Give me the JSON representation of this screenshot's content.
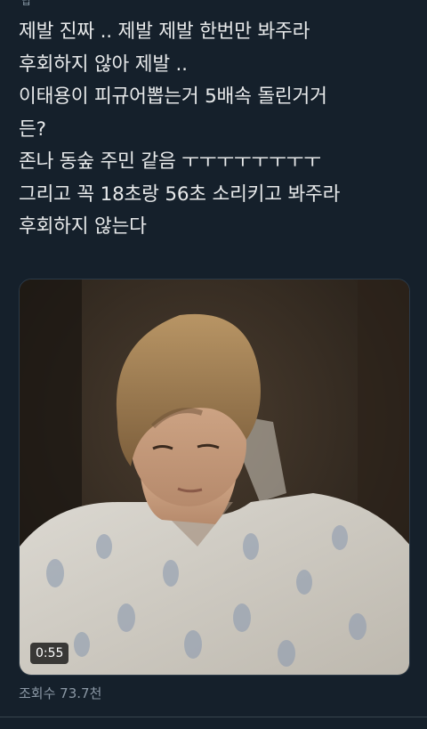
{
  "top_fragment": "답",
  "tweet": {
    "lines": [
      "제발 진짜 .. 제발 제발 한번만 봐주라",
      "후회하지 않아 제발 ..",
      "이태용이 피규어뽑는거 5배속 돌린거거",
      "든?",
      "존나 동숲 주민 같음 ㅜㅜㅜㅜㅜㅜㅜㅜ",
      "그리고 꼭 18초랑 56초 소리키고 봐주라",
      "후회하지 않는다"
    ]
  },
  "media": {
    "type": "video",
    "duration": "0:55"
  },
  "stats": {
    "views": "조회수 73.7천"
  }
}
